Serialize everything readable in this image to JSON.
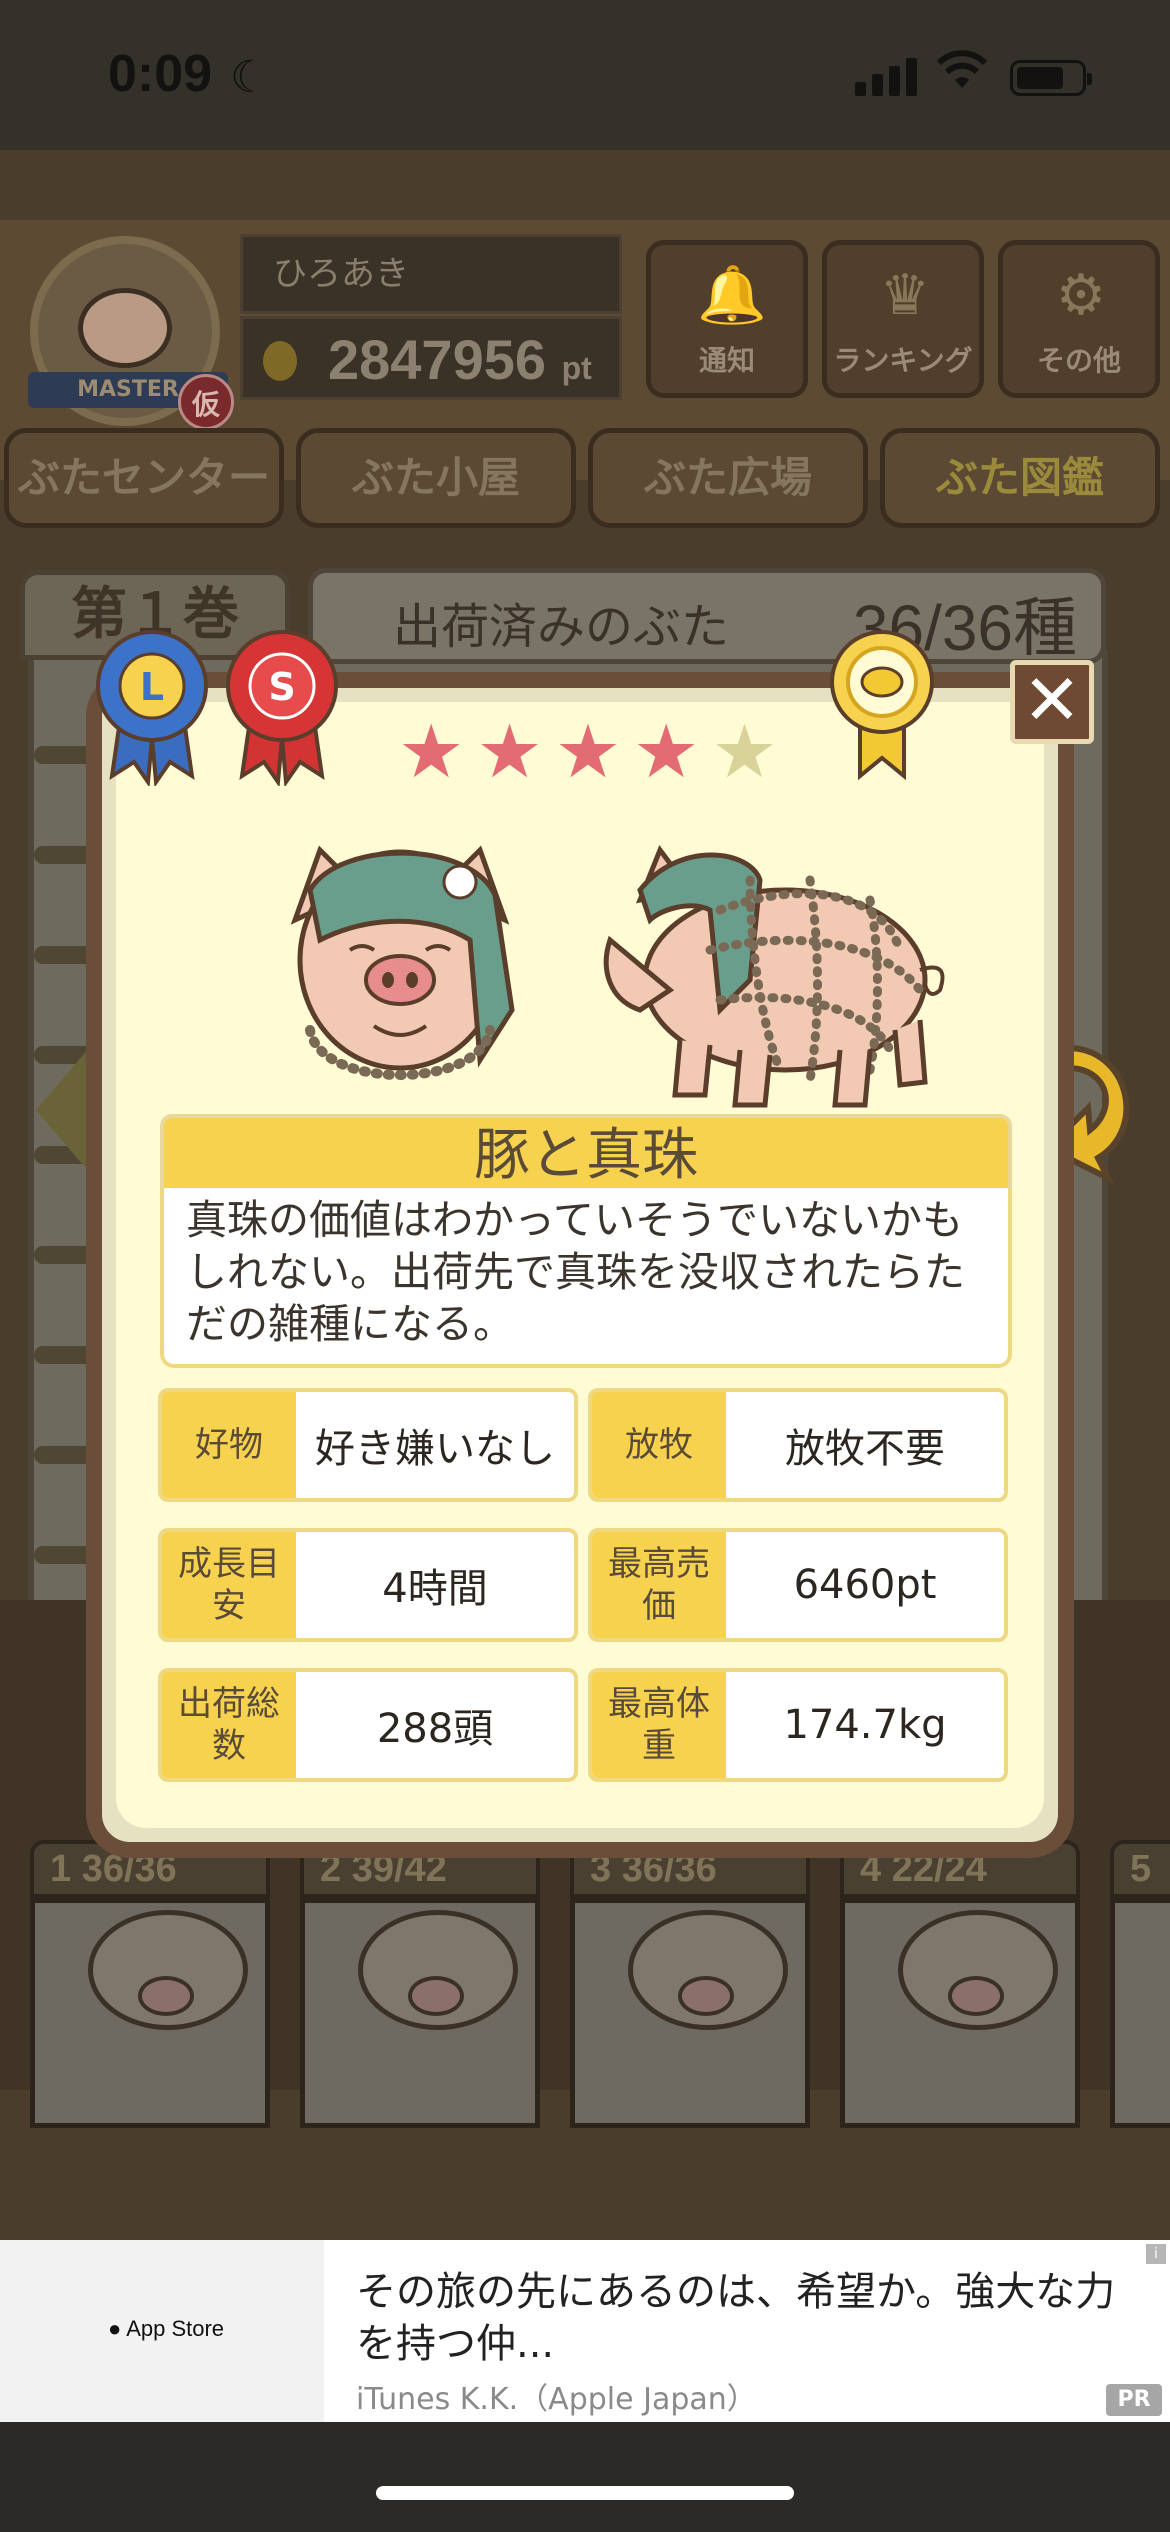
{
  "status_bar": {
    "time": "0:09"
  },
  "header": {
    "master_ribbon": "MASTER",
    "master_tag": "仮",
    "username": "ひろあき",
    "points": "2847956",
    "points_unit": "pt",
    "buttons": [
      {
        "label": "通知",
        "icon": "bell-icon"
      },
      {
        "label": "ランキング",
        "icon": "crown-icon"
      },
      {
        "label": "その他",
        "icon": "gear-icon"
      }
    ]
  },
  "tabs": [
    {
      "label": "ぶたセンター"
    },
    {
      "label": "ぶた小屋"
    },
    {
      "label": "ぶた広場"
    },
    {
      "label": "ぶた図鑑",
      "active": true
    }
  ],
  "book": {
    "volume_label": "第１巻",
    "shipped_label": "出荷済みのぶた",
    "shipped_count": "36/36種"
  },
  "volumes": [
    {
      "number": "1",
      "count": "36/36"
    },
    {
      "number": "2",
      "count": "39/42"
    },
    {
      "number": "3",
      "count": "36/36"
    },
    {
      "number": "4",
      "count": "22/24"
    },
    {
      "number": "5",
      "count": ""
    }
  ],
  "modal": {
    "badges": [
      {
        "letter": "L",
        "color": "#3c72c8"
      },
      {
        "letter": "S",
        "color": "#d73535"
      }
    ],
    "rating": 4,
    "rating_max": 5,
    "name": "豚と真珠",
    "description": "真珠の価値はわかっていそうでいないかもしれない。出荷先で真珠を没収されたらただの雑種になる。",
    "stats": [
      {
        "key": "好物",
        "value": "好き嫌いなし"
      },
      {
        "key": "放牧",
        "value": "放牧不要"
      },
      {
        "key": "成長目安",
        "value": "4時間"
      },
      {
        "key": "最高売価",
        "value": "6460pt"
      },
      {
        "key": "出荷総数",
        "value": "288頭"
      },
      {
        "key": "最高体重",
        "value": "174.7kg"
      }
    ],
    "close_label": "✕"
  },
  "ad": {
    "store": "App Store",
    "headline": "その旅の先にあるのは、希望か。強大な力を持つ仲...",
    "advertiser": "iTunes K.K.（Apple Japan）",
    "pr": "PR",
    "info": "i"
  },
  "colors": {
    "accent_yellow": "#f6d24e",
    "modal_frame": "#6a4e3a",
    "star_filled": "#e36b73",
    "star_empty": "#d9d39a"
  }
}
